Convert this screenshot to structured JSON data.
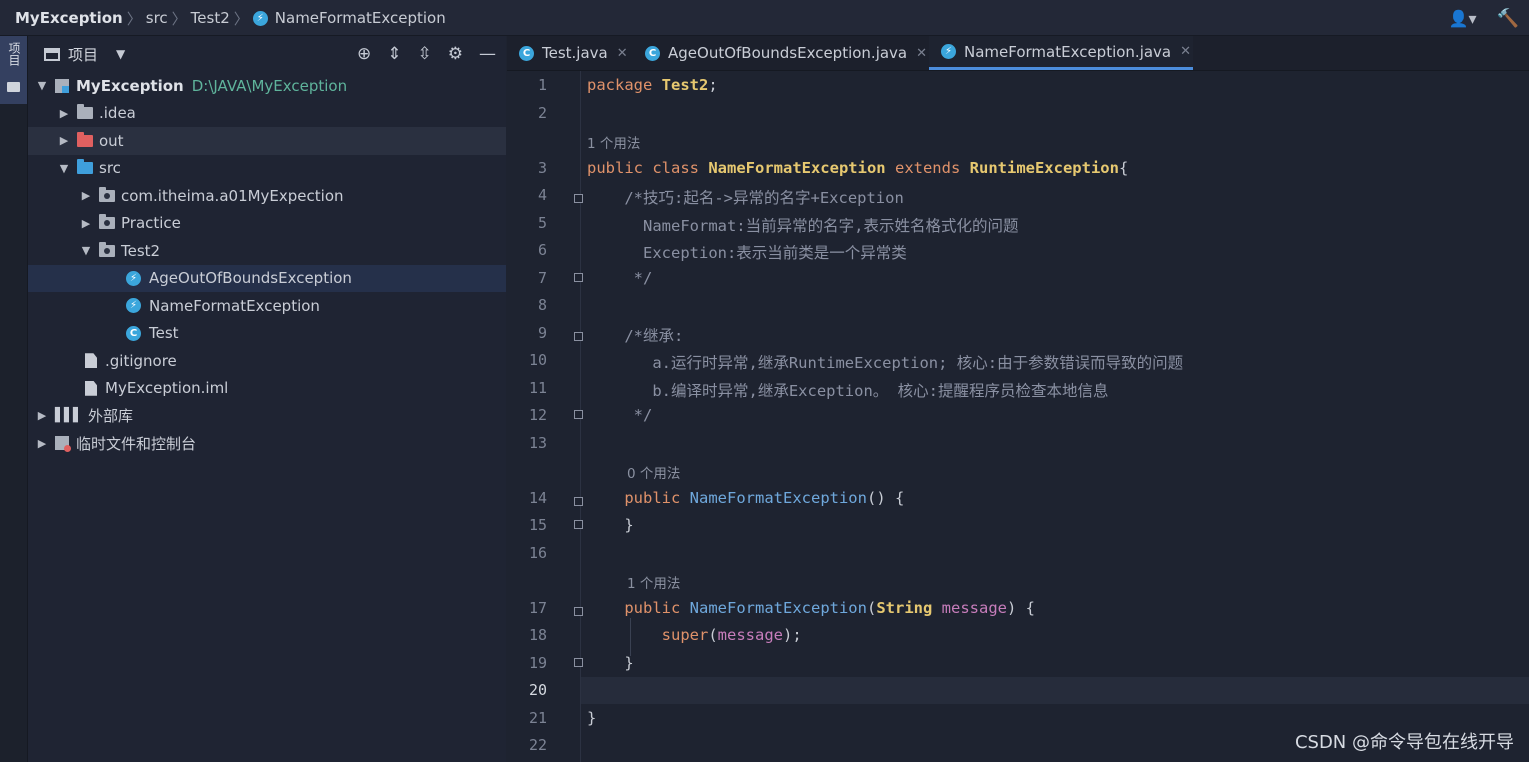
{
  "breadcrumb": {
    "project": "MyException",
    "folder1": "src",
    "folder2": "Test2",
    "file": "NameFormatException"
  },
  "stripe": {
    "project_label": "项目"
  },
  "panel": {
    "title": "项目",
    "tree": {
      "root_name": "MyException",
      "root_path": "D:\\JAVA\\MyException",
      "idea": ".idea",
      "out": "out",
      "src": "src",
      "pkg1": "com.itheima.a01MyExpection",
      "pkg2": "Practice",
      "pkg3": "Test2",
      "cls1": "AgeOutOfBoundsException",
      "cls2": "NameFormatException",
      "cls3": "Test",
      "gitignore": ".gitignore",
      "iml": "MyException.iml",
      "libs": "外部库",
      "scratches": "临时文件和控制台"
    }
  },
  "tabs": [
    {
      "label": "Test.java",
      "icon": "class-icon"
    },
    {
      "label": "AgeOutOfBoundsException.java",
      "icon": "class-icon"
    },
    {
      "label": "NameFormatException.java",
      "icon": "lightning-class-icon",
      "active": true
    }
  ],
  "editor": {
    "line_numbers": [
      "1",
      "2",
      "3",
      "4",
      "5",
      "6",
      "7",
      "8",
      "9",
      "10",
      "11",
      "12",
      "13",
      "14",
      "15",
      "16",
      "17",
      "18",
      "19",
      "20",
      "21",
      "22"
    ],
    "current_line": "20",
    "hints": {
      "h1": "1 个用法",
      "h2": "0 个用法",
      "h3": "1 个用法"
    },
    "code": {
      "l1_kw": "package",
      "l1_name": "Test2",
      "l1_end": ";",
      "l3_kw": "public class",
      "l3_name": "NameFormatException",
      "l3_ext": "extends",
      "l3_parent": "RuntimeException",
      "l3_brace": "{",
      "l4": "    /*技巧:起名->异常的名字+Exception",
      "l5": "      NameFormat:当前异常的名字,表示姓名格式化的问题",
      "l6": "      Exception:表示当前类是一个异常类",
      "l7": "     */",
      "l9": "    /*继承:",
      "l10": "       a.运行时异常,继承RuntimeException; 核心:由于参数错误而导致的问题",
      "l11": "       b.编译时异常,继承Exception。 核心:提醒程序员检查本地信息",
      "l12": "     */",
      "l14_kw": "    public",
      "l14_name": "NameFormatException",
      "l14_rest": "() {",
      "l15": "    }",
      "l17_kw": "    public",
      "l17_name": "NameFormatException",
      "l17_open": "(",
      "l17_type": "String",
      "l17_param": "message",
      "l17_close": ") {",
      "l18_kw": "        super",
      "l18_open": "(",
      "l18_param": "message",
      "l18_close": ");",
      "l19": "    }",
      "l21": "}"
    }
  },
  "watermark": "CSDN @命令导包在线开导",
  "colors": {
    "accent": "#4c8ddc",
    "keyword": "#e0926a",
    "type": "#e6c870",
    "function": "#6fa8dc",
    "param": "#c77dbb",
    "path": "#5fb49c"
  }
}
